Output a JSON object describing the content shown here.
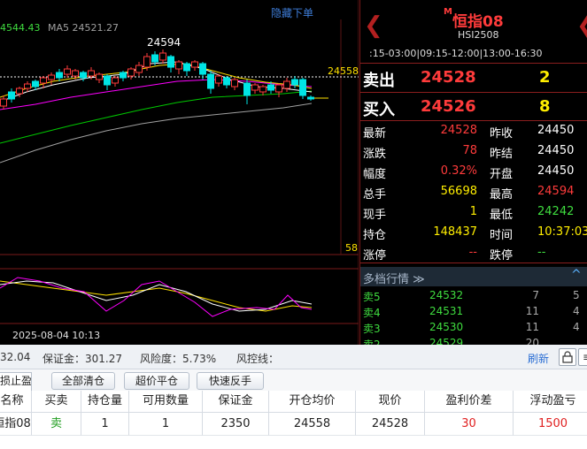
{
  "chart": {
    "ma_legend_1": "4544.43",
    "ma_legend_2": "MA5 24521.27",
    "hide_orders": "隐藏下单",
    "high_label": "24594",
    "line_price_label": "24558",
    "volume_scale_label": "58",
    "bottom_time": "2025-08-04 10:13",
    "colors": {
      "up": "#ff3b3b",
      "down": "#00e5e5",
      "ma_white": "#ffffff",
      "ma_yellow": "#ffe200",
      "ma_magenta": "#ff00ff",
      "ma_green": "#00c800",
      "ma_gray": "#a0a0a0"
    }
  },
  "quote": {
    "badge": "M",
    "name": "恒指08",
    "code": "HSI2508",
    "session": ":15-03:00|09:15-12:00|13:00-16:30",
    "nav_left_icon": "chevron-left",
    "nav_right_icon": "chevron-right",
    "ask": {
      "label": "卖出",
      "price": "24528",
      "volume": "2"
    },
    "bid": {
      "label": "买入",
      "price": "24526",
      "volume": "8"
    },
    "stats_left": [
      {
        "label": "最新",
        "value": "24528",
        "color": "#ff3b3b"
      },
      {
        "label": "涨跌",
        "value": "78",
        "color": "#ff3b3b"
      },
      {
        "label": "幅度",
        "value": "0.32%",
        "color": "#ff3b3b"
      },
      {
        "label": "总手",
        "value": "56698",
        "color": "#ffee00"
      },
      {
        "label": "现手",
        "value": "1",
        "color": "#ffee00"
      },
      {
        "label": "持仓",
        "value": "148437",
        "color": "#ffee00"
      },
      {
        "label": "涨停",
        "value": "--",
        "color": "#ff3b3b"
      }
    ],
    "stats_right": [
      {
        "label": "昨收",
        "value": "24450",
        "color": "#ffffff"
      },
      {
        "label": "昨结",
        "value": "24450",
        "color": "#ffffff"
      },
      {
        "label": "开盘",
        "value": "24450",
        "color": "#ffffff"
      },
      {
        "label": "最高",
        "value": "24594",
        "color": "#ff3b3b"
      },
      {
        "label": "最低",
        "value": "24242",
        "color": "#3fdc3f"
      },
      {
        "label": "时间",
        "value": "10:37:03",
        "color": "#ffee00"
      },
      {
        "label": "跌停",
        "value": "--",
        "color": "#3fdc3f"
      }
    ],
    "depth_title": "多档行情 ≫",
    "depth_caret": "^",
    "depth_rows": [
      {
        "label": "卖5",
        "price": "24532",
        "vol": "7",
        "extra": "5"
      },
      {
        "label": "卖4",
        "price": "24531",
        "vol": "11",
        "extra": "4"
      },
      {
        "label": "卖3",
        "price": "24530",
        "vol": "11",
        "extra": "4"
      },
      {
        "label": "卖2",
        "price": "24529",
        "vol": "20",
        "extra": ""
      }
    ]
  },
  "account": {
    "prefix_value": "32.04",
    "margin": "保证金：301.27",
    "risk": "风险度：5.73%",
    "risk_ctrl": "风控线：",
    "refresh": "刷新",
    "lock_icon": "lock-icon",
    "menu_icon": "menu-icon"
  },
  "actions": {
    "tab_stoploss": "损止盈",
    "clear_all": "全部清仓",
    "close_over_price": "超价平仓",
    "quick_reverse": "快速反手"
  },
  "positions": {
    "headers": [
      "名称",
      "买卖",
      "持仓量",
      "可用数量",
      "保证金",
      "开仓均价",
      "现价",
      "盈利价差",
      "浮动盈亏"
    ],
    "rows": [
      [
        "恒指08",
        "卖",
        "1",
        "1",
        "2350",
        "24558",
        "24528",
        "30",
        "1500"
      ]
    ]
  }
}
